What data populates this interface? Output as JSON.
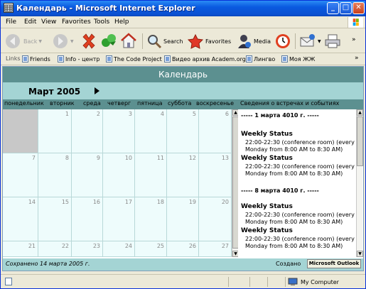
{
  "window": {
    "title": "Календарь - Microsoft Internet Explorer",
    "min_symbol": "_",
    "max_symbol": "□",
    "close_symbol": "✕"
  },
  "menu": [
    "File",
    "Edit",
    "View",
    "Favorites",
    "Tools",
    "Help"
  ],
  "toolbar": {
    "back": "Back",
    "search": "Search",
    "favorites": "Favorites",
    "media": "Media"
  },
  "links": {
    "label": "Links",
    "items": [
      "Friends",
      "Info - центр",
      "The Code Project",
      "Видео архив Academ.org",
      "Лингво",
      "Моя ЖЖ"
    ],
    "more": "»"
  },
  "calendar": {
    "header": "Календарь",
    "month": "Март 2005",
    "weekdays": [
      "понедельник",
      "вторник",
      "среда",
      "четверг",
      "пятница",
      "суббота",
      "воскресенье"
    ],
    "events_header": "Сведения о встречах и событиях",
    "weeks": [
      [
        "",
        "1",
        "2",
        "3",
        "4",
        "5",
        "6"
      ],
      [
        "7",
        "8",
        "9",
        "10",
        "11",
        "12",
        "13"
      ],
      [
        "14",
        "15",
        "16",
        "17",
        "18",
        "19",
        "20"
      ],
      [
        "21",
        "22",
        "23",
        "24",
        "25",
        "26",
        "27"
      ]
    ]
  },
  "events": {
    "groups": [
      {
        "date": "----- 1 марта 4010 г. -----",
        "items": [
          {
            "title": "Weekly Status",
            "line1": "22:00-22:30 (conference room) (every",
            "line2": "Monday from 8:00 AM to 8:30 AM)"
          },
          {
            "title": "Weekly Status",
            "line1": "22:00-22:30 (conference room) (every",
            "line2": "Monday from 8:00 AM to 8:30 AM)"
          }
        ]
      },
      {
        "date": "----- 8 марта 4010 г. -----",
        "items": [
          {
            "title": "Weekly Status",
            "line1": "22:00-22:30 (conference room) (every",
            "line2": "Monday from 8:00 AM to 8:30 AM)"
          },
          {
            "title": "Weekly Status",
            "line1": "22:00-22:30 (conference room) (every",
            "line2": "Monday from 8:00 AM to 8:30 AM)"
          }
        ]
      }
    ]
  },
  "footer": {
    "saved": "Сохранено 14 марта 2005 г.",
    "created": "Создано",
    "outlook": "Microsoft Outlook"
  },
  "status": {
    "zone": "My Computer"
  },
  "colors": {
    "header_bg": "#5c9090",
    "month_bg": "#a4d4d4",
    "cell_bg": "#eefcfc",
    "empty_cell_bg": "#c8c8c8"
  }
}
